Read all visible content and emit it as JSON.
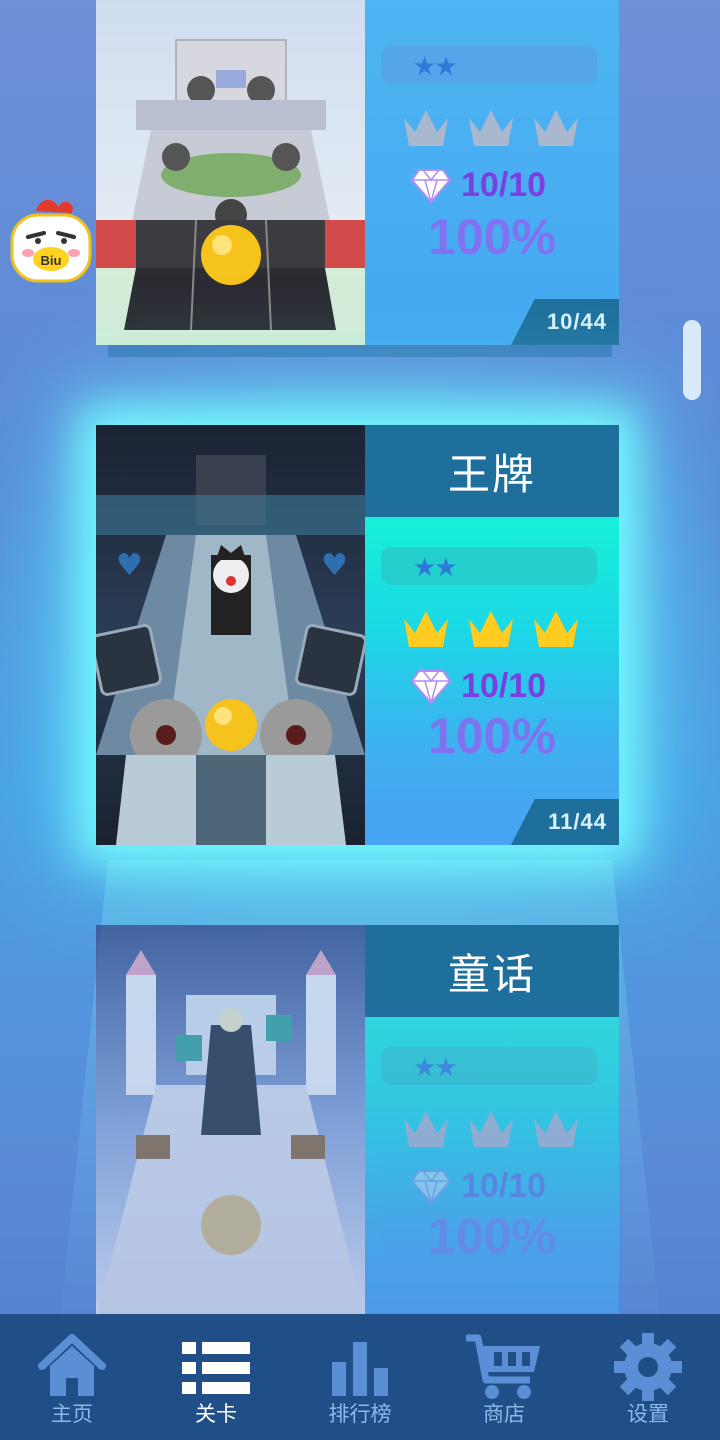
{
  "levels": [
    {
      "title": "",
      "stars": "★★",
      "diamonds": "10/10",
      "percent": "100%",
      "count": "10/44",
      "crowns": 3,
      "state": "completed"
    },
    {
      "title": "王牌",
      "stars": "★★",
      "diamonds": "10/10",
      "percent": "100%",
      "count": "11/44",
      "crowns": 3,
      "state": "selected"
    },
    {
      "title": "童话",
      "stars": "★★",
      "diamonds": "10/10",
      "percent": "100%",
      "count": "",
      "crowns": 3,
      "state": "locked"
    }
  ],
  "avatar": {
    "badge_text": "Biu"
  },
  "nav": {
    "items": [
      {
        "label": "主页",
        "icon": "home-icon"
      },
      {
        "label": "关卡",
        "icon": "list-icon",
        "active": true
      },
      {
        "label": "排行榜",
        "icon": "leaderboard-icon"
      },
      {
        "label": "商店",
        "icon": "cart-icon"
      },
      {
        "label": "设置",
        "icon": "gear-icon"
      }
    ]
  },
  "colors": {
    "crown_gold": "#ffcc1f",
    "crown_gray": "#a9b7cf",
    "title_bar": "#1f6f9c",
    "gem_text": "#7b3fe0",
    "nav_bg": "#1f4f86"
  }
}
